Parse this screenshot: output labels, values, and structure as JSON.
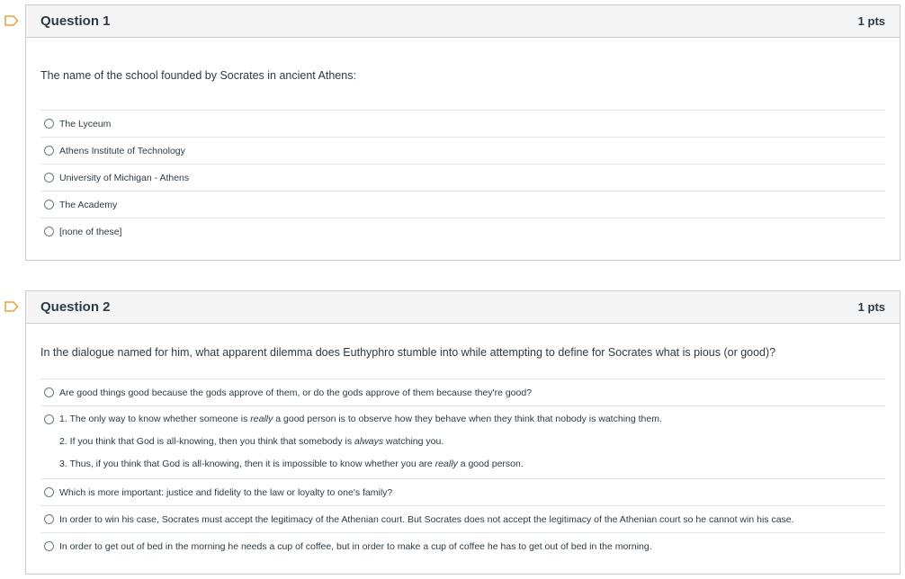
{
  "questions": [
    {
      "title": "Question 1",
      "points": "1 pts",
      "text": "The name of the school founded by Socrates in ancient Athens:",
      "answers": [
        "The Lyceum",
        "Athens Institute of Technology",
        "University of Michigan - Athens",
        "The Academy",
        "[none of these]"
      ]
    },
    {
      "title": "Question 2",
      "points": "1 pts",
      "text": "In the dialogue named for him, what apparent dilemma does Euthyphro stumble into while attempting to define for Socrates what is pious (or good)?",
      "answers": [
        "Are good things good because the gods approve of them, or do the gods approve of them because they're good?",
        {
          "line1_a": "1. The only way to know whether someone is ",
          "line1_em": "really",
          "line1_b": " a good person is to observe how they behave when they think that nobody is watching them.",
          "line2_a": "2. If you think that God is all-knowing, then you think that somebody is ",
          "line2_em": "always",
          "line2_b": " watching you.",
          "line3_a": "3. Thus, if you think that God is all-knowing, then it is impossible to know whether you are ",
          "line3_em": "really",
          "line3_b": " a good person."
        },
        "Which is more important: justice and fidelity to the law or loyalty to one's family?",
        "In order to win his case, Socrates must accept the legitimacy of the Athenian court. But Socrates does not accept the legitimacy of the Athenian court so he cannot win his case.",
        "In order to get out of bed in the morning he needs a cup of coffee, but in order to make a cup of coffee he has to get out of bed in the morning."
      ]
    }
  ],
  "icons": {
    "flag": "bookmark-flag-icon"
  },
  "colors": {
    "flag": "#e8a33d",
    "border": "#c7cdd1",
    "header_bg": "#f5f5f5",
    "text": "#2d3b45"
  }
}
